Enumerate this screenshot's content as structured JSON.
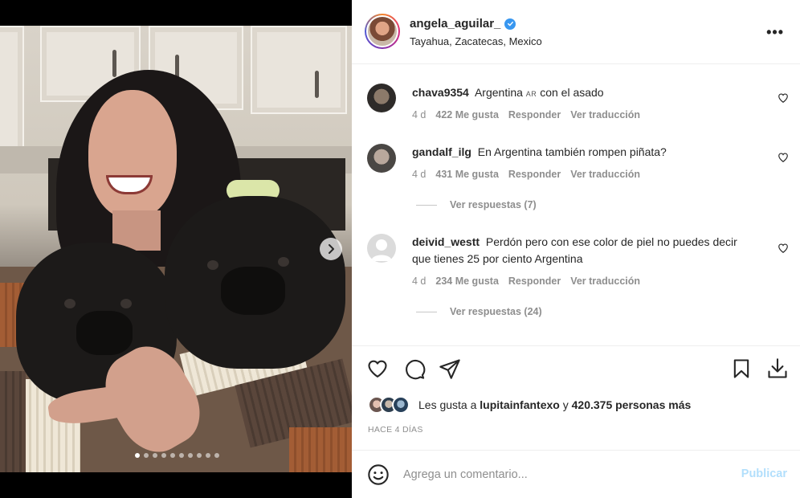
{
  "post": {
    "username": "angela_aguilar_",
    "location": "Tayahua, Zacatecas, Mexico",
    "more_label": "•••"
  },
  "media": {
    "slide_count": 10,
    "active_slide": 1
  },
  "comments": [
    {
      "username": "chava9354",
      "text": "Argentina",
      "flag": "AR",
      "text_after": "con el asado",
      "age": "4 d",
      "likes": "422 Me gusta",
      "reply": "Responder",
      "translate": "Ver traducción"
    },
    {
      "username": "gandalf_ilg",
      "text": "En Argentina también rompen piñata?",
      "age": "4 d",
      "likes": "431 Me gusta",
      "reply": "Responder",
      "translate": "Ver traducción",
      "view_replies": "Ver respuestas (7)"
    },
    {
      "username": "deivid_westt",
      "text": "Perdón pero con ese color de piel no puedes decir que tienes 25 por ciento Argentina",
      "age": "4 d",
      "likes": "234 Me gusta",
      "reply": "Responder",
      "translate": "Ver traducción",
      "view_replies": "Ver respuestas (24)"
    }
  ],
  "likes": {
    "prefix": "Les gusta a",
    "user": "lupitainfantexo",
    "joiner": "y",
    "others": "420.375 personas más"
  },
  "timestamp": "Hace 4 días",
  "composer": {
    "placeholder": "Agrega un comentario...",
    "publish_label": "Publicar"
  },
  "colors": {
    "verified": "#3897f0",
    "publish_disabled": "#b2dffc",
    "secondary_text": "#8e8e8e"
  }
}
